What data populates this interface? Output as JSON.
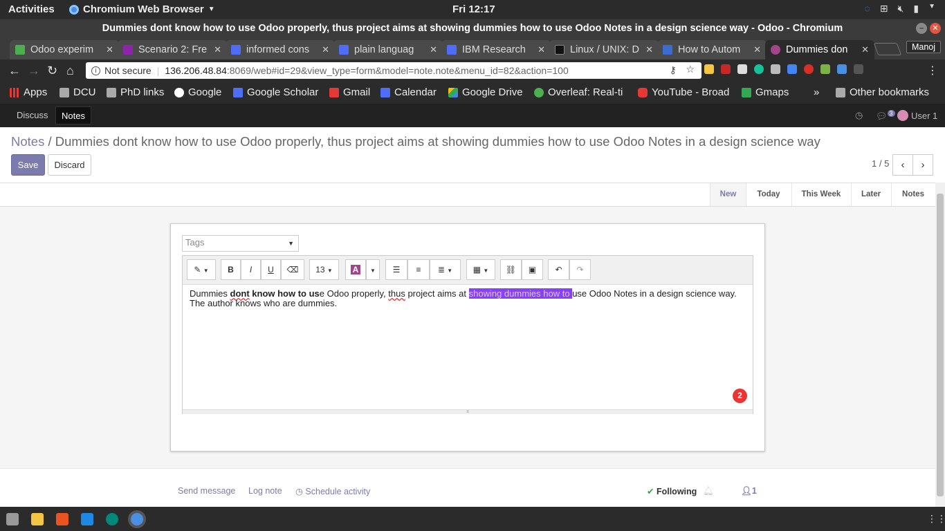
{
  "gnome": {
    "activities": "Activities",
    "app_name": "Chromium Web Browser",
    "clock": "Fri 12:17"
  },
  "window_title": "Dummies dont know how to use Odoo properly, thus project aims at showing dummies how to use Odoo Notes in a design science way - Odoo - Chromium",
  "tabs": [
    {
      "label": "Odoo experim",
      "color": "#4caf50"
    },
    {
      "label": "Scenario 2: Fre",
      "color": "#8e24aa"
    },
    {
      "label": "informed cons",
      "color": "#4f6ef7"
    },
    {
      "label": "plain languag",
      "color": "#4f6ef7"
    },
    {
      "label": "IBM Research",
      "color": "#4f6ef7"
    },
    {
      "label": "Linux / UNIX: D",
      "color": "#222"
    },
    {
      "label": "How to Autom",
      "color": "#3b6cd1"
    },
    {
      "label": "Dummies don",
      "color": "#a24689"
    }
  ],
  "profile": "Manoj",
  "address": {
    "security": "Not secure",
    "host": "136.206.48.84",
    "path": ":8069/web#id=29&view_type=form&model=note.note&menu_id=82&action=100"
  },
  "bookmarks": [
    {
      "label": "Apps",
      "color": "#e53935"
    },
    {
      "label": "DCU",
      "color": "#aaa"
    },
    {
      "label": "PhD links",
      "color": "#aaa"
    },
    {
      "label": "Google",
      "color": "#4285f4"
    },
    {
      "label": "Google Scholar",
      "color": "#4f6ef7"
    },
    {
      "label": "Gmail",
      "color": "#e53935"
    },
    {
      "label": "Calendar",
      "color": "#4f6ef7"
    },
    {
      "label": "Google Drive",
      "color": "#fbbc05"
    },
    {
      "label": "Overleaf: Real-ti",
      "color": "#4caf50"
    },
    {
      "label": "YouTube - Broad",
      "color": "#e53935"
    },
    {
      "label": "Gmaps",
      "color": "#34a853"
    }
  ],
  "bookmarks_more": "»",
  "other_bookmarks": "Other bookmarks",
  "odoo_menu": {
    "discuss": "Discuss",
    "notes": "Notes",
    "messages_count": "3",
    "user": "User 1"
  },
  "breadcrumb": {
    "root": "Notes",
    "separator": "/",
    "current": "Dummies dont know how to use Odoo properly, thus project aims at showing dummies how to use Odoo Notes in a design science way"
  },
  "buttons": {
    "save": "Save",
    "discard": "Discard"
  },
  "pager": "1 / 5",
  "stages": [
    "New",
    "Today",
    "This Week",
    "Later",
    "Notes"
  ],
  "tags_placeholder": "Tags",
  "editor": {
    "font_size": "13",
    "text_parts": {
      "p1": "Dummies ",
      "p2": "dont",
      "p3": " know how to us",
      "p4": "e Odoo properly, ",
      "p5": "thus",
      "p6": " project aims at ",
      "p7": "showing dummies how to ",
      "p8": "use Odoo Notes in a design science way.",
      "line2": "The author knows who are dummies."
    },
    "badge": "2"
  },
  "chatter": {
    "send": "Send message",
    "log": "Log note",
    "schedule": "Schedule activity",
    "following": "Following",
    "followers": "1"
  }
}
